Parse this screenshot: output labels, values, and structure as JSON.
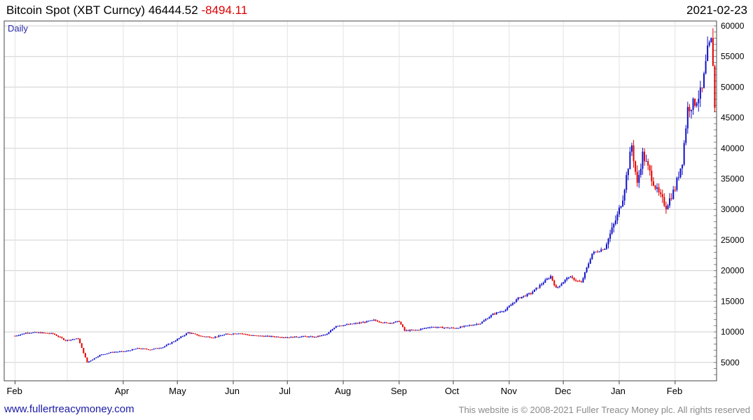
{
  "header": {
    "title": "Bitcoin Spot (XBT Curncy) 46444.52",
    "change": "-8494.11",
    "date": "2021-02-23"
  },
  "footer": {
    "site": "www.fullertreacymoney.com",
    "copyright": "This website is © 2008-2021 Fuller Treacy Money plc. All rights reserved"
  },
  "colors": {
    "up": "#1010c8",
    "down": "#e00000",
    "grid": "#cfcfcf",
    "change": "#dd0000",
    "link": "#1a1aa6"
  },
  "chart_data": {
    "type": "candlestick",
    "frequency": "Daily",
    "xticks": [
      "Feb",
      "Apr",
      "May",
      "Jun",
      "Jul",
      "Aug",
      "Sep",
      "Oct",
      "Nov",
      "Dec",
      "Jan",
      "Feb"
    ],
    "yticks": [
      5000,
      10000,
      15000,
      20000,
      25000,
      30000,
      35000,
      40000,
      45000,
      50000,
      55000,
      60000
    ],
    "ylim": [
      2000,
      60800
    ],
    "y_axis_position": "right",
    "grid": true,
    "series": [
      {
        "date": "2020-02-01",
        "close": 9350
      },
      {
        "date": "2020-02-08",
        "close": 9900
      },
      {
        "date": "2020-02-15",
        "close": 9850
      },
      {
        "date": "2020-02-22",
        "close": 9700
      },
      {
        "date": "2020-02-29",
        "close": 8600
      },
      {
        "date": "2020-03-07",
        "close": 8900
      },
      {
        "date": "2020-03-12",
        "close": 5000
      },
      {
        "date": "2020-03-19",
        "close": 6200
      },
      {
        "date": "2020-03-26",
        "close": 6700
      },
      {
        "date": "2020-04-02",
        "close": 6800
      },
      {
        "date": "2020-04-09",
        "close": 7300
      },
      {
        "date": "2020-04-16",
        "close": 7100
      },
      {
        "date": "2020-04-23",
        "close": 7500
      },
      {
        "date": "2020-04-30",
        "close": 8600
      },
      {
        "date": "2020-05-07",
        "close": 9900
      },
      {
        "date": "2020-05-14",
        "close": 9300
      },
      {
        "date": "2020-05-21",
        "close": 9100
      },
      {
        "date": "2020-05-28",
        "close": 9600
      },
      {
        "date": "2020-06-04",
        "close": 9800
      },
      {
        "date": "2020-06-11",
        "close": 9400
      },
      {
        "date": "2020-06-18",
        "close": 9300
      },
      {
        "date": "2020-06-25",
        "close": 9200
      },
      {
        "date": "2020-07-02",
        "close": 9100
      },
      {
        "date": "2020-07-09",
        "close": 9250
      },
      {
        "date": "2020-07-16",
        "close": 9150
      },
      {
        "date": "2020-07-23",
        "close": 9600
      },
      {
        "date": "2020-07-28",
        "close": 11000
      },
      {
        "date": "2020-08-04",
        "close": 11200
      },
      {
        "date": "2020-08-11",
        "close": 11500
      },
      {
        "date": "2020-08-18",
        "close": 11900
      },
      {
        "date": "2020-08-25",
        "close": 11400
      },
      {
        "date": "2020-09-01",
        "close": 11700
      },
      {
        "date": "2020-09-04",
        "close": 10200
      },
      {
        "date": "2020-09-11",
        "close": 10300
      },
      {
        "date": "2020-09-18",
        "close": 10800
      },
      {
        "date": "2020-09-25",
        "close": 10700
      },
      {
        "date": "2020-10-02",
        "close": 10600
      },
      {
        "date": "2020-10-09",
        "close": 11000
      },
      {
        "date": "2020-10-16",
        "close": 11400
      },
      {
        "date": "2020-10-23",
        "close": 12900
      },
      {
        "date": "2020-10-30",
        "close": 13600
      },
      {
        "date": "2020-11-06",
        "close": 15500
      },
      {
        "date": "2020-11-13",
        "close": 16300
      },
      {
        "date": "2020-11-20",
        "close": 18100
      },
      {
        "date": "2020-11-24",
        "close": 19100
      },
      {
        "date": "2020-11-27",
        "close": 17100
      },
      {
        "date": "2020-12-04",
        "close": 19000
      },
      {
        "date": "2020-12-11",
        "close": 18000
      },
      {
        "date": "2020-12-17",
        "close": 22800
      },
      {
        "date": "2020-12-24",
        "close": 23700
      },
      {
        "date": "2020-12-31",
        "close": 29000
      },
      {
        "date": "2021-01-03",
        "close": 32000
      },
      {
        "date": "2021-01-08",
        "close": 40500
      },
      {
        "date": "2021-01-11",
        "close": 34000
      },
      {
        "date": "2021-01-14",
        "close": 39000
      },
      {
        "date": "2021-01-18",
        "close": 36000
      },
      {
        "date": "2021-01-22",
        "close": 33000
      },
      {
        "date": "2021-01-27",
        "close": 30500
      },
      {
        "date": "2021-02-01",
        "close": 33500
      },
      {
        "date": "2021-02-05",
        "close": 38000
      },
      {
        "date": "2021-02-08",
        "close": 46500
      },
      {
        "date": "2021-02-12",
        "close": 47500
      },
      {
        "date": "2021-02-16",
        "close": 49500
      },
      {
        "date": "2021-02-19",
        "close": 55800
      },
      {
        "date": "2021-02-21",
        "close": 57400
      },
      {
        "date": "2021-02-22",
        "close": 54000
      },
      {
        "date": "2021-02-23",
        "close": 46444.52
      }
    ]
  }
}
